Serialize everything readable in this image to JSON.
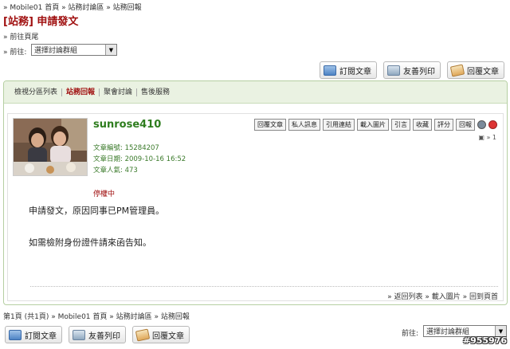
{
  "breadcrumb": {
    "text": "» Mobile01 首頁 » 站務討論區 » 站務回報"
  },
  "thread": {
    "title": "[站務] 申請發文"
  },
  "nav": {
    "go_bottom": "» 前往頁尾",
    "goto_label": "» 前往:",
    "goto_select_value": "選擇討論群組"
  },
  "toolbar": {
    "subscribe": "訂閱文章",
    "print": "友善列印",
    "reply": "回覆文章"
  },
  "tabs": [
    {
      "label": "檢視分區列表",
      "active": false
    },
    {
      "label": "站務回報",
      "active": true
    },
    {
      "label": "聚會討論",
      "active": false
    },
    {
      "label": "售後服務",
      "active": false
    }
  ],
  "post": {
    "username": "sunrose410",
    "article_id": "文章編號: 15284207",
    "article_date": "文章日期: 2009-10-16 16:52",
    "popularity": "文章人氣: 473",
    "status": "停權中",
    "actions": [
      "回覆文章",
      "私人訊息",
      "引用連結",
      "載入圖片",
      "引言",
      "收藏",
      "評分",
      "回報"
    ],
    "floor": "» 1",
    "body_lines": [
      "申請發文，原因同事已PM管理員。",
      "如需檢附身份證件請來函告知。"
    ],
    "footer_links": "» 返回列表 » 載入圖片 » 回到頁首"
  },
  "bottom": {
    "breadcrumb": "第1頁 (共1頁) » Mobile01 首頁 » 站務討論區 » 站務回報",
    "goto_label": "前往:",
    "goto_select_value": "選擇討論群組"
  },
  "watermark": "#955976",
  "colors": {
    "title_red": "#a01010",
    "username_green": "#2e7d1e",
    "tab_bg": "#eaf2e2",
    "panel_border": "#b5cfa2"
  }
}
